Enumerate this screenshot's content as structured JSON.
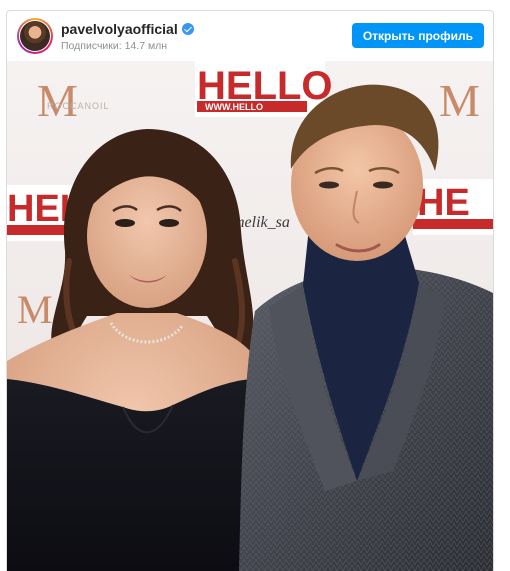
{
  "post": {
    "username": "pavelvolyaofficial",
    "followers_label": "Подписчики: 14.7 млн",
    "open_profile_label": "Открыть профиль"
  },
  "photo": {
    "backdrop_brand": "HELLO",
    "backdrop_url": "WWW.HELLO",
    "backdrop_sponsor": "MOROCCANOIL",
    "watermark": "melik_sa"
  },
  "icons": {
    "verified": "verified-badge-icon",
    "avatar": "profile-avatar"
  },
  "colors": {
    "button": "#0095f6",
    "verified": "#3897f0",
    "backdrop_red": "#c62a2a"
  }
}
